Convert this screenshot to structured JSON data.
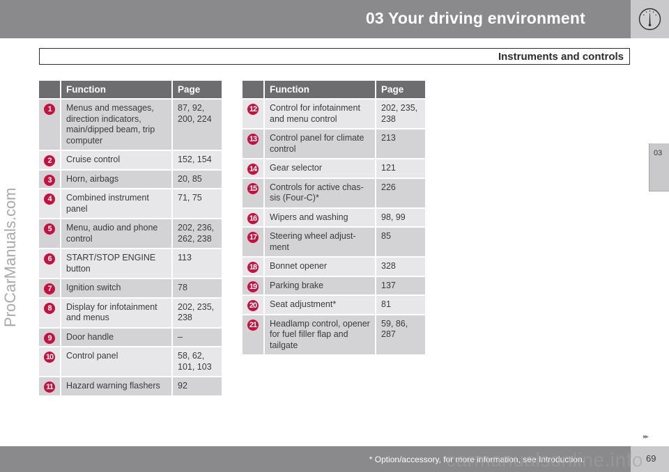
{
  "header": {
    "chapter_title": "03 Your driving environment",
    "icon": "gauge-icon",
    "section_title": "Instruments and controls"
  },
  "side_tab": {
    "label": "03"
  },
  "watermarks": {
    "left": "ProCarManuals.com",
    "bottom": "carmanualsonline.info"
  },
  "colors": {
    "badge": "#c8103e",
    "header_band": "#8a8a8d",
    "table_header": "#6d6d70",
    "row_dark": "#d3d3d5",
    "row_light": "#e7e7e9"
  },
  "tables": {
    "columns": {
      "function": "Function",
      "page": "Page"
    },
    "left": [
      {
        "num": "1",
        "function": "Menus and messages, direction indicators, main/dipped beam, trip computer",
        "page": "87, 92, 200, 224"
      },
      {
        "num": "2",
        "function": "Cruise control",
        "page": "152, 154"
      },
      {
        "num": "3",
        "function": "Horn, airbags",
        "page": "20, 85"
      },
      {
        "num": "4",
        "function": "Combined instrument panel",
        "page": "71, 75"
      },
      {
        "num": "5",
        "function": "Menu, audio and phone control",
        "page": "202, 236, 262, 238"
      },
      {
        "num": "6",
        "function": "START/STOP ENGINE button",
        "page": "113"
      },
      {
        "num": "7",
        "function": "Ignition switch",
        "page": "78"
      },
      {
        "num": "8",
        "function": "Display for infotainment and menus",
        "page": "202, 235, 238"
      },
      {
        "num": "9",
        "function": "Door handle",
        "page": "–"
      },
      {
        "num": "10",
        "function": "Control panel",
        "page": "58, 62, 101, 103"
      },
      {
        "num": "11",
        "function": "Hazard warning flashers",
        "page": "92"
      }
    ],
    "right": [
      {
        "num": "12",
        "function": "Control for infotainment and menu control",
        "page": "202, 235, 238"
      },
      {
        "num": "13",
        "function": "Control panel for climate control",
        "page": "213"
      },
      {
        "num": "14",
        "function": "Gear selector",
        "page": "121"
      },
      {
        "num": "15",
        "function": "Controls for active chas-sis (Four-C)*",
        "page": "226"
      },
      {
        "num": "16",
        "function": "Wipers and washing",
        "page": "98, 99"
      },
      {
        "num": "17",
        "function": "Steering wheel adjust-ment",
        "page": "85"
      },
      {
        "num": "18",
        "function": "Bonnet opener",
        "page": "328"
      },
      {
        "num": "19",
        "function": "Parking brake",
        "page": "137"
      },
      {
        "num": "20",
        "function": "Seat adjustment*",
        "page": "81"
      },
      {
        "num": "21",
        "function": "Headlamp control, opener for fuel filler flap and tailgate",
        "page": "59, 86, 287"
      }
    ]
  },
  "footer": {
    "footnote": "* Option/accessory, for more information, see Introduction.",
    "page_number": "69",
    "next_page_icon": "double-arrow-right-icon",
    "next_page_glyph": "▸▸"
  }
}
